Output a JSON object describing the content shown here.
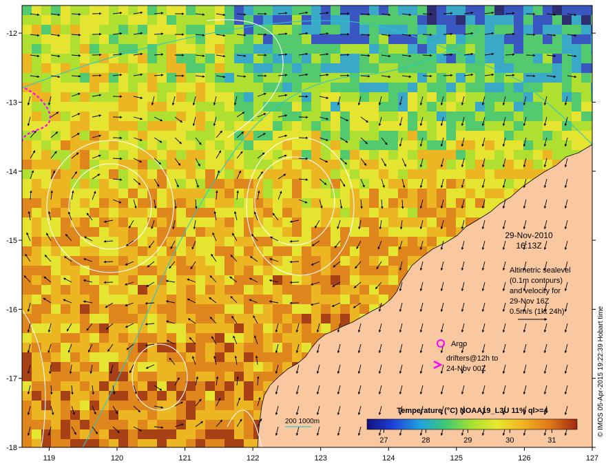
{
  "map": {
    "lon_min": 118.6,
    "lon_max": 127.0,
    "lat_min": -18.0,
    "lat_max": -11.6,
    "lon_ticks": [
      "119",
      "120",
      "121",
      "122",
      "123",
      "124",
      "125",
      "126",
      "127"
    ],
    "lat_ticks": [
      "-12",
      "-13",
      "-14",
      "-15",
      "-16",
      "-17",
      "-18"
    ],
    "land_color": "#f9c8a0",
    "contour_color": "#ffffff",
    "isobath_color": "#28c8c8",
    "arrow_color": "#000000"
  },
  "annotation": {
    "date": "29-Nov-2010",
    "time": "16:13Z",
    "info_lines": [
      "Altimetric sealevel",
      "(0.1m contours)",
      "and velocity for",
      "29-Nov 16Z",
      "0.5m/s (1kt 24h)"
    ]
  },
  "legend": {
    "argo_label": "Argo",
    "drifter_line1": "drifters@12h to",
    "drifter_line2": "24-Nov 00Z",
    "argo_color": "#ff00ff",
    "drifter_color": "#ff00ff",
    "isobath_label": "200  1000m"
  },
  "colorbar": {
    "title": "Temperature (°C) NOAA19_L3U 11% ql>=4",
    "ticks": [
      "27",
      "28",
      "29",
      "30",
      "31"
    ],
    "stops": [
      "#10107a",
      "#1f3fd8",
      "#1fa0e0",
      "#3cc878",
      "#a8e030",
      "#e8e830",
      "#f0b020",
      "#e07818",
      "#a02810"
    ]
  },
  "credit": "© IMOS 05-Apr-2015 19:22:39 Hobart time"
}
